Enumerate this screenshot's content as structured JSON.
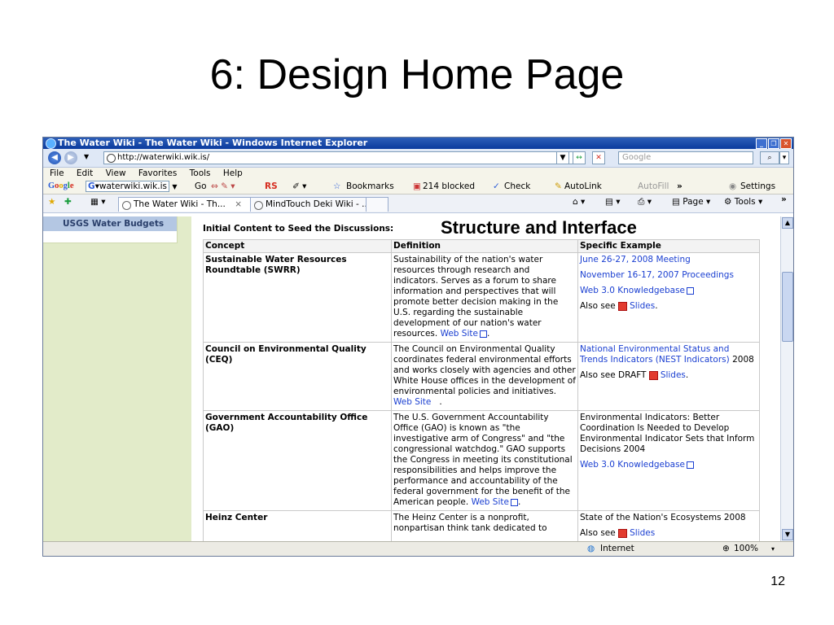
{
  "slide": {
    "title": "6: Design Home Page",
    "overlay_label": "Structure and Interface",
    "page_number": "12"
  },
  "window": {
    "title": "The Water Wiki - The Water Wiki - Windows Internet Explorer"
  },
  "address_bar": {
    "url": "http://waterwiki.wik.is/",
    "search_placeholder": "Google"
  },
  "menu": {
    "items": [
      "File",
      "Edit",
      "View",
      "Favorites",
      "Tools",
      "Help"
    ]
  },
  "google_toolbar": {
    "logo": "Google",
    "search_value": "waterwiki.wik.is",
    "go": "Go",
    "rs": "RS",
    "bookmarks": "Bookmarks",
    "blocked": "214 blocked",
    "check": "Check",
    "autolink": "AutoLink",
    "autofill": "AutoFill",
    "more": "»",
    "settings": "Settings"
  },
  "tabs": [
    {
      "label": "The Water Wiki - Th...",
      "close": "×"
    },
    {
      "label": "MindTouch Deki Wiki - ..."
    }
  ],
  "command_bar": {
    "page": "Page",
    "tools": "Tools",
    "more": "»"
  },
  "sidebar": {
    "heading": "USGS Water Budgets"
  },
  "main": {
    "intro": "Initial Content to Seed the Discussions:",
    "columns": [
      "Concept",
      "Definition",
      "Specific Example"
    ],
    "rows": [
      {
        "concept": "Sustainable Water Resources Roundtable (SWRR)",
        "definition": "Sustainability of the nation's water resources through research and indicators. Serves as a forum to share information and perspectives that will promote better decision making in the U.S. regarding the sustainable development of our nation's water resources.",
        "definition_link": "Web Site",
        "ex_link1": "June 26-27, 2008 Meeting",
        "ex_link2": "November 16-17, 2007 Proceedings",
        "ex_link3": "Web 3.0 Knowledgebase",
        "ex_also": "Also see",
        "ex_slides": "Slides"
      },
      {
        "concept": "Council on Environmental Quality (CEQ)",
        "definition": "The Council on Environmental Quality coordinates federal environmental efforts and works closely with agencies and other White House offices in the development of environmental policies and initiatives.",
        "definition_link": "Web Site",
        "ex_link1": "National Environmental Status and Trends Indicators (NEST Indicators)",
        "ex_year": "2008",
        "ex_also": "Also see DRAFT",
        "ex_slides": "Slides"
      },
      {
        "concept": "Government Accountability Office (GAO)",
        "definition": "The U.S. Government Accountability Office (GAO) is known as \"the investigative arm of Congress\" and \"the congressional watchdog.\" GAO supports the Congress in meeting its constitutional responsibilities and helps improve the performance and accountability of the federal government for the benefit of the American people.",
        "definition_link": "Web Site",
        "ex_text": "Environmental Indicators: Better Coordination Is Needed to Develop Environmental Indicator Sets that Inform Decisions 2004",
        "ex_link1": "Web 3.0 Knowledgebase"
      },
      {
        "concept": "Heinz Center",
        "definition": "The Heinz Center is a nonprofit, nonpartisan think tank dedicated to",
        "ex_text": "State of the Nation's Ecosystems 2008",
        "ex_also": "Also see",
        "ex_slides": "Slides"
      }
    ]
  },
  "status_bar": {
    "zone": "Internet",
    "zoom": "100%"
  }
}
